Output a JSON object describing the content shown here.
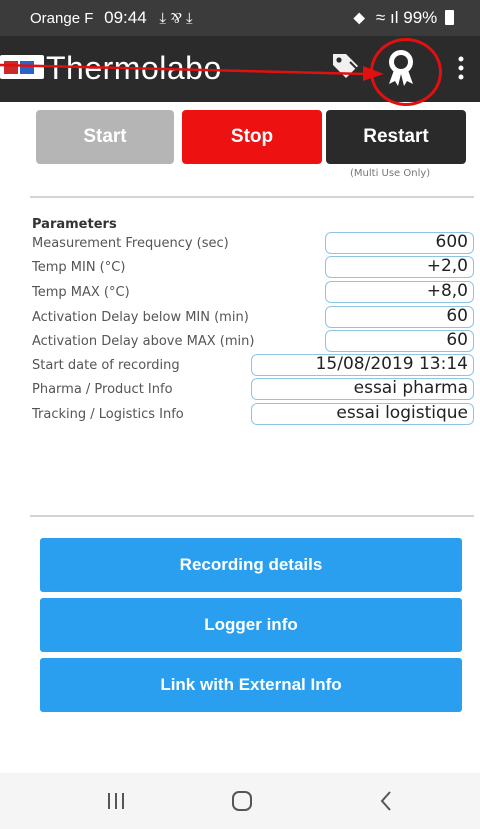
{
  "status": {
    "carrier": "Orange F",
    "time": "09:44",
    "icons": "⤓ ⅋ ⤓",
    "battery": "99%"
  },
  "app": {
    "title": "Thermolabo"
  },
  "icons": {
    "tag": "tag-icon",
    "badge": "award-badge-icon",
    "menu": "more-vertical-icon",
    "logo": "thermolabo-logo-icon"
  },
  "controls": {
    "start": "Start",
    "stop": "Stop",
    "restart": "Restart",
    "restart_note": "(Multi Use Only)"
  },
  "parameters": {
    "heading": "Parameters",
    "rows": [
      {
        "label": "Measurement Frequency (sec)",
        "value": "600"
      },
      {
        "label": "Temp MIN (°C)",
        "value": "+2,0"
      },
      {
        "label": "Temp MAX (°C)",
        "value": "+8,0"
      },
      {
        "label": "Activation Delay below MIN (min)",
        "value": "60"
      },
      {
        "label": "Activation Delay above MAX (min)",
        "value": "60"
      },
      {
        "label": "Start date of recording",
        "value": "15/08/2019 13:14"
      },
      {
        "label": "Pharma / Product Info",
        "value": "essai pharma"
      },
      {
        "label": "Tracking / Logistics Info",
        "value": "essai logistique"
      }
    ]
  },
  "actions": {
    "recording_details": "Recording details",
    "logger_info": "Logger info",
    "link_external": "Link with External Info"
  },
  "colors": {
    "appbar": "#2b2b2b",
    "start": "#b5b5b5",
    "stop": "#ee1111",
    "restart": "#2a2a2a",
    "action": "#2a9ff0",
    "field_border": "#8ec5e0",
    "annotation": "#e01010"
  }
}
